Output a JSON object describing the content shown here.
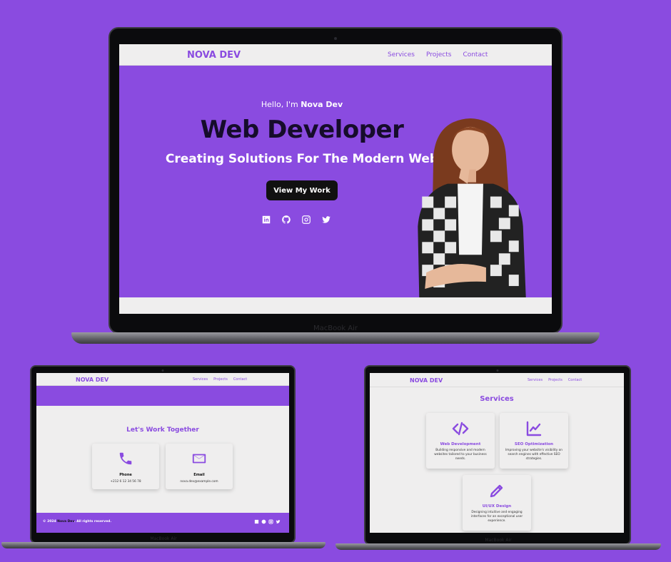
{
  "brand": "NOVA DEV",
  "nav": {
    "services": "Services",
    "projects": "Projects",
    "contact": "Contact"
  },
  "laptop_label": "MacBook Air",
  "hero": {
    "greeting_prefix": "Hello, I'm ",
    "greeting_name": "Nova Dev",
    "title": "Web Developer",
    "subtitle": "Creating Solutions For The Modern Web",
    "cta": "View My Work",
    "socials": [
      "linkedin-icon",
      "github-icon",
      "instagram-icon",
      "twitter-icon"
    ]
  },
  "contact": {
    "heading": "Let's Work Together",
    "phone": {
      "label": "Phone",
      "value": "+212 6 12 34 56 78",
      "icon": "phone-icon"
    },
    "email": {
      "label": "Email",
      "value": "nova.dev@example.com",
      "icon": "envelope-icon"
    }
  },
  "footer": {
    "prefix": "© 2024 ",
    "name": "Nova Dev",
    "suffix": ". All rights reserved."
  },
  "services": {
    "heading": "Services",
    "items": [
      {
        "title": "Web Development",
        "desc": "Building responsive and modern websites tailored to your business needs.",
        "icon": "code-icon"
      },
      {
        "title": "SEO Optimization",
        "desc": "Improving your website's visibility on search engines with effective SEO strategies.",
        "icon": "chart-line-icon"
      },
      {
        "title": "UI/UX Design",
        "desc": "Designing intuitive and engaging interfaces for an exceptional user experience.",
        "icon": "pencil-icon"
      }
    ]
  },
  "colors": {
    "accent": "#8a4be0",
    "dark": "#160c2b",
    "light": "#efeeee"
  }
}
